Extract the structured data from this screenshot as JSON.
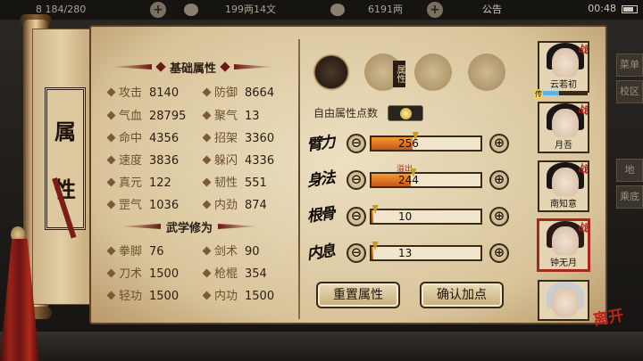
{
  "topbar": {
    "stamina": "8 184/280",
    "money": "199两14文",
    "yuanbao": "6191两",
    "notice": "公告",
    "time": "00:48"
  },
  "background_menu": [
    "菜单",
    "校区",
    "地",
    "乘底"
  ],
  "scroll_title": [
    "属",
    "性"
  ],
  "basic_section": {
    "title": "基础属性",
    "stats": [
      {
        "label": "攻击",
        "value": "8140"
      },
      {
        "label": "防御",
        "value": "8664"
      },
      {
        "label": "气血",
        "value": "28795"
      },
      {
        "label": "聚气",
        "value": "13"
      },
      {
        "label": "命中",
        "value": "4356"
      },
      {
        "label": "招架",
        "value": "3360"
      },
      {
        "label": "速度",
        "value": "3836"
      },
      {
        "label": "躲闪",
        "value": "4336"
      },
      {
        "label": "真元",
        "value": "122"
      },
      {
        "label": "韧性",
        "value": "551"
      },
      {
        "label": "罡气",
        "value": "1036"
      },
      {
        "label": "内劲",
        "value": "874"
      }
    ]
  },
  "martial_section": {
    "title": "武学修为",
    "stats": [
      {
        "label": "拳脚",
        "value": "76"
      },
      {
        "label": "剑术",
        "value": "90"
      },
      {
        "label": "刀术",
        "value": "1500"
      },
      {
        "label": "枪棍",
        "value": "354"
      },
      {
        "label": "轻功",
        "value": "1500"
      },
      {
        "label": "内功",
        "value": "1500"
      }
    ]
  },
  "tab_tag": "属性",
  "free_points_label": "自由属性点数",
  "attributes": [
    {
      "label": "臂力",
      "value": "256",
      "fill": 0.38,
      "mark": 0.4
    },
    {
      "label": "身法",
      "value": "244",
      "fill": 0.36,
      "mark": 0.38,
      "overflow": "溢出"
    },
    {
      "label": "根骨",
      "value": "10",
      "fill": 0.02,
      "mark": 0.03
    },
    {
      "label": "内息",
      "value": "13",
      "fill": 0.02,
      "mark": 0.03
    }
  ],
  "minus_symbol": "⊖",
  "plus_symbol": "⊕",
  "buttons": {
    "reset": "重置属性",
    "confirm": "确认加点"
  },
  "heroes": [
    {
      "name": "云若初",
      "zhan": "战",
      "exp_tag": "传",
      "exp": 0.4
    },
    {
      "name": "月吾",
      "zhan": "战"
    },
    {
      "name": "南知意",
      "zhan": "战"
    },
    {
      "name": "钟无月",
      "zhan": "战"
    },
    {
      "name": "",
      "zhan": ""
    }
  ],
  "leave_label": "离开",
  "colors": {
    "accent_red": "#a8261c",
    "bar_fill": "#f49a32",
    "parchment": "#ece0c2"
  }
}
